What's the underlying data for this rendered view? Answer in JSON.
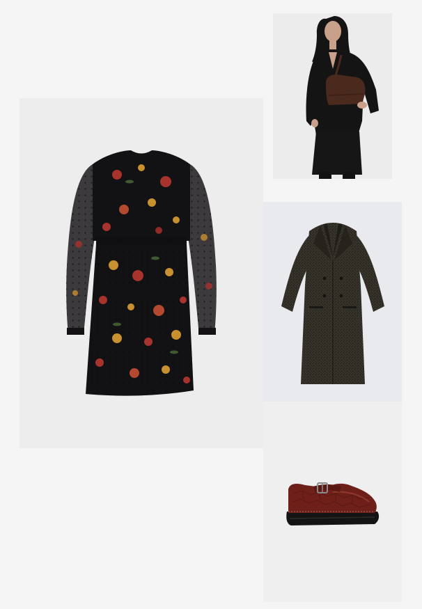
{
  "colors": {
    "page_background": "#f5f5f5",
    "dress_tile_bg": "#ededed",
    "model_tile_bg": "#ececec",
    "coat_tile_bg": "#e9eaed",
    "shoe_tile_bg": "#efefef",
    "dress_base": "#121214",
    "floral_red": "#a8322c",
    "floral_gold": "#c9902f",
    "coat_tweed": "#2e2b24",
    "bag_brown": "#4a2a1c",
    "shoe_oxblood": "#6e1f18"
  },
  "items": [
    {
      "icon": "floral-dress-icon"
    },
    {
      "icon": "model-with-bag-icon"
    },
    {
      "icon": "tweed-coat-icon"
    },
    {
      "icon": "mary-jane-shoe-icon"
    }
  ]
}
